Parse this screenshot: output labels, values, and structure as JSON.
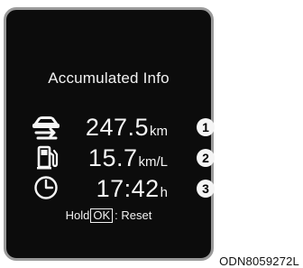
{
  "screen": {
    "title": "Accumulated Info",
    "items": [
      {
        "icon": "car-distance-icon",
        "value": "247.5",
        "unit": "km",
        "marker": "1"
      },
      {
        "icon": "fuel-pump-icon",
        "value": "15.7",
        "unit": "km/L",
        "marker": "2"
      },
      {
        "icon": "clock-icon",
        "value": "17:42",
        "unit": "h",
        "marker": "3"
      }
    ],
    "reset": {
      "prefix": "Hold",
      "key": "OK",
      "suffix": ": Reset"
    }
  },
  "caption": "ODN8059272L",
  "colors": {
    "background": "#0c0c0c",
    "border": "#9a9a9a",
    "text": "#f5f5f5"
  }
}
